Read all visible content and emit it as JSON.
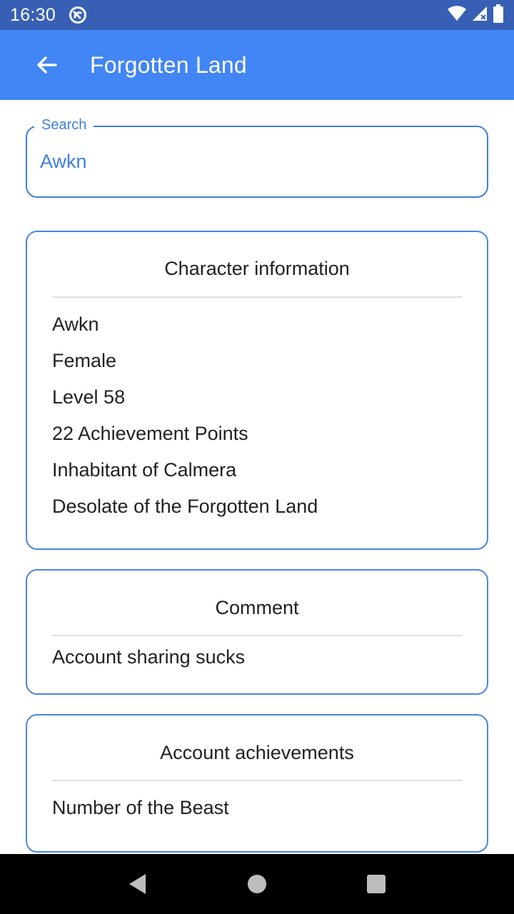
{
  "status_bar": {
    "time": "16:30",
    "icons": [
      "app-notification-icon",
      "wifi-icon",
      "signal-icon",
      "battery-icon"
    ]
  },
  "app_bar": {
    "title": "Forgotten Land",
    "back_icon": "arrow-back-icon"
  },
  "search": {
    "label": "Search",
    "value": "Awkn"
  },
  "character_card": {
    "title": "Character information",
    "lines": [
      "Awkn",
      "Female",
      "Level 58",
      "22 Achievement Points",
      "Inhabitant of Calmera",
      "Desolate of the Forgotten Land"
    ]
  },
  "comment_card": {
    "title": "Comment",
    "text": "Account sharing sucks"
  },
  "achievements_card": {
    "title": "Account achievements",
    "items": [
      "Number of the Beast"
    ]
  },
  "nav_bar": {
    "icons": [
      "back-triangle-icon",
      "home-circle-icon",
      "recents-square-icon"
    ]
  },
  "colors": {
    "status_bar": "#3760b5",
    "app_bar": "#4285f4",
    "accent": "#3f7fe0",
    "card_border": "#4a86e0"
  }
}
